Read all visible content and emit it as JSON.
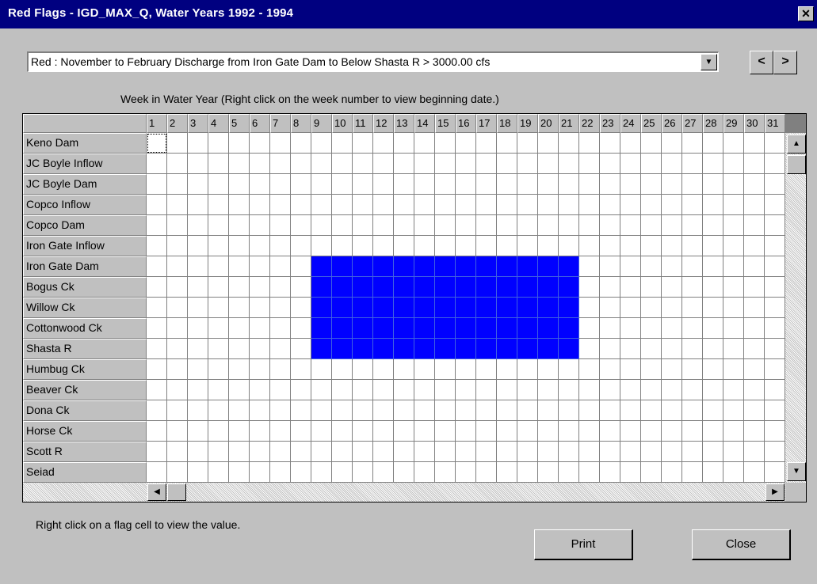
{
  "window": {
    "title": "Red Flags - IGD_MAX_Q, Water Years 1992 - 1994",
    "close_glyph": "✕"
  },
  "flag_select": {
    "selected": "Red  : November to February Discharge from Iron Gate Dam to Below Shasta R > 3000.00 cfs",
    "dropdown_icon": "triangle-down-icon"
  },
  "nav": {
    "prev_label": "<",
    "next_label": ">"
  },
  "grid": {
    "caption": "Week in Water Year  (Right click on the week number to view beginning date.)",
    "weeks": [
      "1",
      "2",
      "3",
      "4",
      "5",
      "6",
      "7",
      "8",
      "9",
      "10",
      "11",
      "12",
      "13",
      "14",
      "15",
      "16",
      "17",
      "18",
      "19",
      "20",
      "21",
      "22",
      "23",
      "24",
      "25",
      "26",
      "27",
      "28",
      "29",
      "30",
      "31"
    ],
    "locations": [
      "Keno Dam",
      "JC Boyle Inflow",
      "JC Boyle Dam",
      "Copco Inflow",
      "Copco Dam",
      "Iron Gate Inflow",
      "Iron Gate Dam",
      "Bogus Ck",
      "Willow Ck",
      "Cottonwood Ck",
      "Shasta R",
      "Humbug Ck",
      "Beaver Ck",
      "Dona Ck",
      "Horse Ck",
      "Scott R",
      "Seiad"
    ],
    "flagged": {
      "locations": [
        "Iron Gate Dam",
        "Bogus Ck",
        "Willow Ck",
        "Cottonwood Ck",
        "Shasta R"
      ],
      "weeks_from": 9,
      "weeks_to": 21
    },
    "flag_color": "#0000ff",
    "selected_cell": {
      "location": "Keno Dam",
      "week": 1
    }
  },
  "hint": "Right click on a flag cell to view the value.",
  "buttons": {
    "print": "Print",
    "close": "Close"
  }
}
